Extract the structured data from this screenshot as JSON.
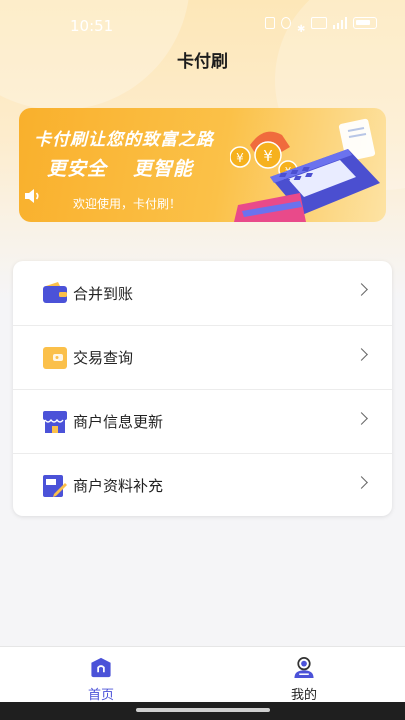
{
  "status_bar": {
    "time": "10:51"
  },
  "header": {
    "title": "卡付刷"
  },
  "banner": {
    "title": "卡付刷让您的致富之路",
    "sub_left": "更安全",
    "sub_right": "更智能",
    "welcome": "欢迎使用，卡付刷！"
  },
  "menu": {
    "items": [
      {
        "label": "合并到账",
        "icon": "wallet-icon"
      },
      {
        "label": "交易查询",
        "icon": "card-wallet-icon"
      },
      {
        "label": "商户信息更新",
        "icon": "store-icon"
      },
      {
        "label": "商户资料补充",
        "icon": "edit-document-icon"
      }
    ]
  },
  "tabbar": {
    "home_label": "首页",
    "mine_label": "我的"
  },
  "colors": {
    "accent": "#4b52d8",
    "banner": "#f9b02c",
    "icon_yellow": "#fbc04a"
  }
}
